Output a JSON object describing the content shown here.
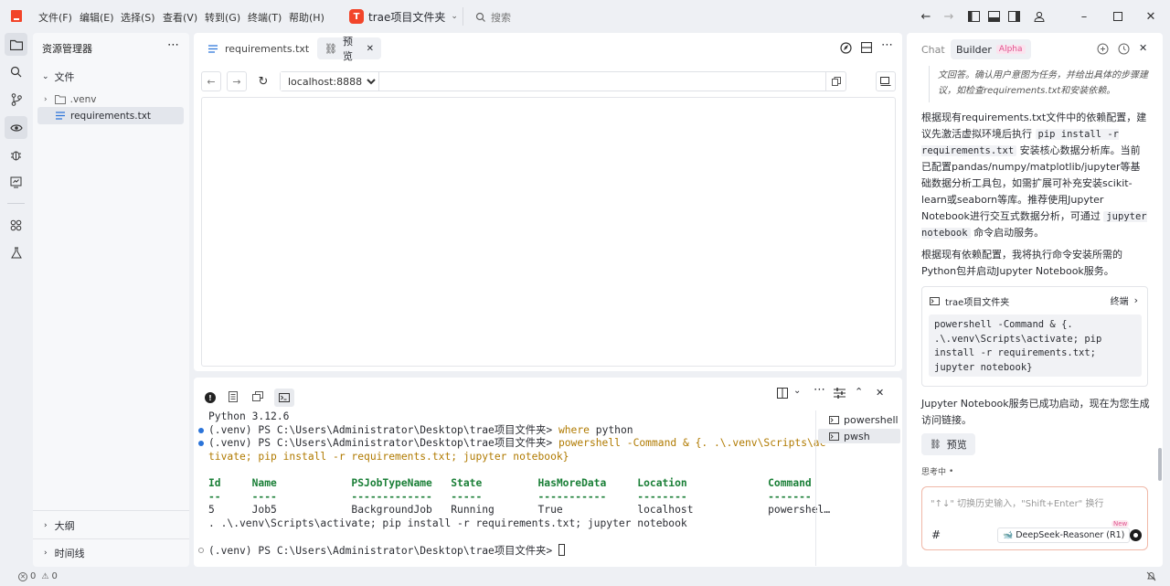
{
  "menu": {
    "items": [
      "文件(F)",
      "编辑(E)",
      "选择(S)",
      "查看(V)",
      "转到(G)",
      "终端(T)",
      "帮助(H)"
    ],
    "project_badge": "T",
    "project_name": "trae项目文件夹",
    "search_placeholder": "搜索"
  },
  "explorer": {
    "title": "资源管理器",
    "section": "文件",
    "items": [
      ".venv",
      "requirements.txt"
    ],
    "outline": "大纲",
    "timeline": "时间线"
  },
  "editor": {
    "tabs": [
      {
        "label": "requirements.txt",
        "active": false
      },
      {
        "label": "预览",
        "active": true
      }
    ],
    "url": "localhost:8888"
  },
  "terminal": {
    "lines": [
      {
        "text": "Python 3.12.6"
      },
      {
        "prompt": "(.venv) PS C:\\Users\\Administrator\\Desktop\\trae项目文件夹> ",
        "cmd_kw": "where",
        "cmd_rest": " python"
      },
      {
        "prompt": "(.venv) PS C:\\Users\\Administrator\\Desktop\\trae项目文件夹> ",
        "cmd_kw": "powershell",
        "cmd_rest": " -Command & {. .\\.venv\\Scripts\\ac"
      },
      {
        "cont": "tivate; pip install -r requirements.txt; jupyter notebook}"
      },
      {
        "text": ""
      },
      {
        "header": "Id     Name            PSJobTypeName   State         HasMoreData     Location             Command"
      },
      {
        "header": "--     ----            -------------   -----         -----------     --------             -------"
      },
      {
        "text": "5      Job5            BackgroundJob   Running       True            localhost            powershel…"
      },
      {
        "text": ". .\\.venv\\Scripts\\activate; pip install -r requirements.txt; jupyter notebook"
      },
      {
        "text": ""
      },
      {
        "prompt_last": "(.venv) PS C:\\Users\\Administrator\\Desktop\\trae项目文件夹> "
      }
    ],
    "sessions": [
      "powershell",
      "pwsh"
    ]
  },
  "chat": {
    "tab_chat": "Chat",
    "tab_builder": "Builder",
    "alpha_badge": "Alpha",
    "thinking_tail": "文回答。确认用户意图为任务，并给出具体的步骤建议，如检查requirements.txt和安装依赖。",
    "para1_a": "根据现有requirements.txt文件中的依赖配置，建议先激活虚拟环境后执行",
    "para1_code": "pip install -r requirements.txt",
    "para1_b": "安装核心数据分析库。当前已配置pandas/numpy/matplotlib/jupyter等基础数据分析工具包，如需扩展可补充安装scikit-learn或seaborn等库。推荐使用Jupyter Notebook进行交互式数据分析，可通过",
    "para1_code2": "jupyter notebook",
    "para1_c": "命令启动服务。",
    "para2": "根据现有依赖配置，我将执行命令安装所需的Python包并启动Jupyter Notebook服务。",
    "cmd_folder": "trae项目文件夹",
    "cmd_terminal_label": "终端",
    "cmd_code": "powershell -Command & {. .\\.venv\\Scripts\\activate; pip install -r requirements.txt; jupyter notebook}",
    "para3": "Jupyter Notebook服务已成功启动，现在为您生成访问链接。",
    "preview_button": "预览",
    "thinking": "思考中",
    "input_placeholder": "\"↑↓\" 切换历史输入，\"Shift+Enter\" 换行",
    "hash": "#",
    "model": "DeepSeek-Reasoner (R1)",
    "new_badge": "New"
  },
  "status": {
    "errors": "0",
    "warnings": "0"
  },
  "colors": {
    "accent": "#f2452a",
    "terminal_blue": "#2b74d9",
    "alpha": "#e0548f"
  }
}
